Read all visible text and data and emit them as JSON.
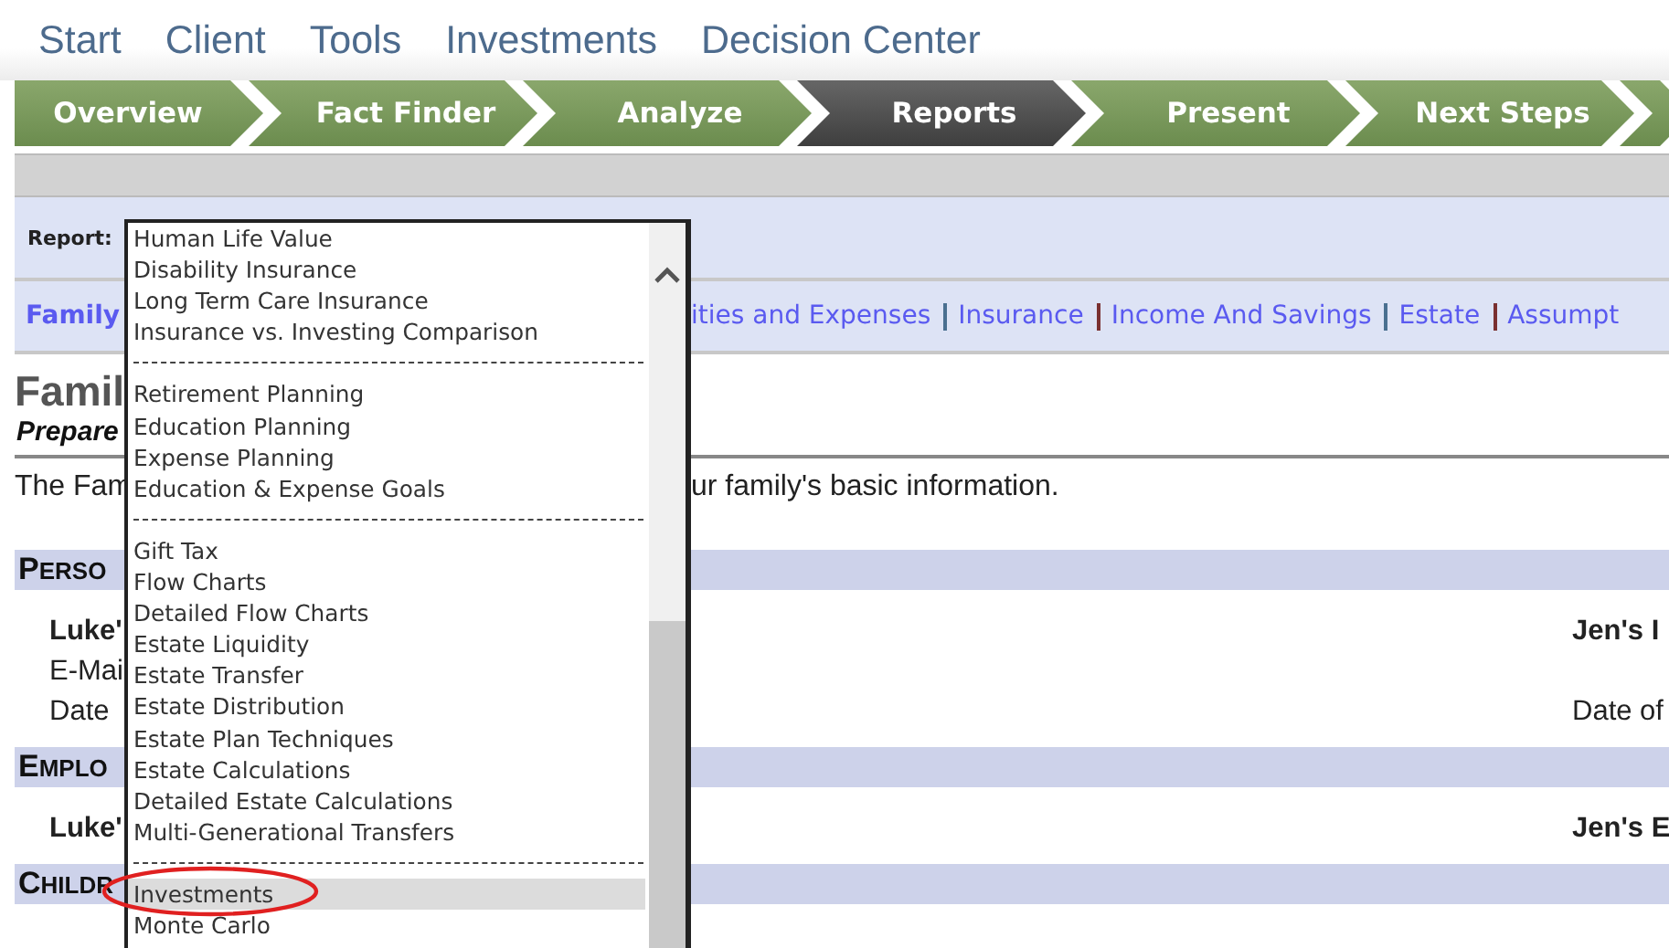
{
  "top_menu": [
    {
      "label": "Start"
    },
    {
      "label": "Client"
    },
    {
      "label": "Tools"
    },
    {
      "label": "Investments"
    },
    {
      "label": "Decision Center"
    }
  ],
  "steps": [
    {
      "label": "Overview",
      "selected": false
    },
    {
      "label": "Fact Finder",
      "selected": false
    },
    {
      "label": "Analyze",
      "selected": false
    },
    {
      "label": "Reports",
      "selected": true
    },
    {
      "label": "Present",
      "selected": false
    },
    {
      "label": "Next Steps",
      "selected": false
    }
  ],
  "report_bar": {
    "label": "Report:"
  },
  "report_dropdown": {
    "options": [
      {
        "kind": "option",
        "label": "Human Life Value",
        "selected": false
      },
      {
        "kind": "option",
        "label": "Disability Insurance",
        "selected": false
      },
      {
        "kind": "option",
        "label": "Long Term Care Insurance",
        "selected": false
      },
      {
        "kind": "option",
        "label": "Insurance vs. Investing Comparison",
        "selected": false
      },
      {
        "kind": "separator"
      },
      {
        "kind": "option",
        "label": "Retirement Planning",
        "selected": false
      },
      {
        "kind": "option",
        "label": "Education Planning",
        "selected": false
      },
      {
        "kind": "option",
        "label": "Expense Planning",
        "selected": false
      },
      {
        "kind": "option",
        "label": "Education & Expense Goals",
        "selected": false
      },
      {
        "kind": "separator"
      },
      {
        "kind": "option",
        "label": "Gift Tax",
        "selected": false
      },
      {
        "kind": "option",
        "label": "Flow Charts",
        "selected": false
      },
      {
        "kind": "option",
        "label": "Detailed Flow Charts",
        "selected": false
      },
      {
        "kind": "option",
        "label": "Estate Liquidity",
        "selected": false
      },
      {
        "kind": "option",
        "label": "Estate Transfer",
        "selected": false
      },
      {
        "kind": "option",
        "label": "Estate Distribution",
        "selected": false
      },
      {
        "kind": "option",
        "label": "Estate Plan Techniques",
        "selected": false
      },
      {
        "kind": "option",
        "label": "Estate Calculations",
        "selected": false
      },
      {
        "kind": "option",
        "label": "Detailed Estate Calculations",
        "selected": false
      },
      {
        "kind": "option",
        "label": "Multi-Generational Transfers",
        "selected": false
      },
      {
        "kind": "separator"
      },
      {
        "kind": "option",
        "label": "Investments",
        "selected": true
      },
      {
        "kind": "option",
        "label": "Monte Carlo",
        "selected": false
      }
    ]
  },
  "links_left": [
    {
      "label": "Family",
      "selected": true
    }
  ],
  "links_right": [
    {
      "label": "ities and Expenses",
      "selected": false
    },
    {
      "label": "Insurance",
      "selected": false
    },
    {
      "label": "Income And Savings",
      "selected": false
    },
    {
      "label": "Estate",
      "selected": false
    },
    {
      "label": "Assumpt",
      "selected": false
    }
  ],
  "heading": {
    "title": "Famil",
    "subtitle": "Prepare"
  },
  "intro": {
    "left": "The Fam",
    "right": "ur family's basic information."
  },
  "sections": [
    {
      "title": "PERSO",
      "rows": [
        {
          "left": "Luke'",
          "right": "Jen's I",
          "bold": true
        },
        {
          "left": "E-Mai",
          "bold": false
        },
        {
          "left": "Date",
          "right": "Date of",
          "bold": false
        }
      ]
    },
    {
      "title": "EMPLO",
      "rows": [
        {
          "left": "Luke'",
          "right": "Jen's E",
          "bold": true
        }
      ]
    },
    {
      "title": "CHILDR"
    }
  ]
}
